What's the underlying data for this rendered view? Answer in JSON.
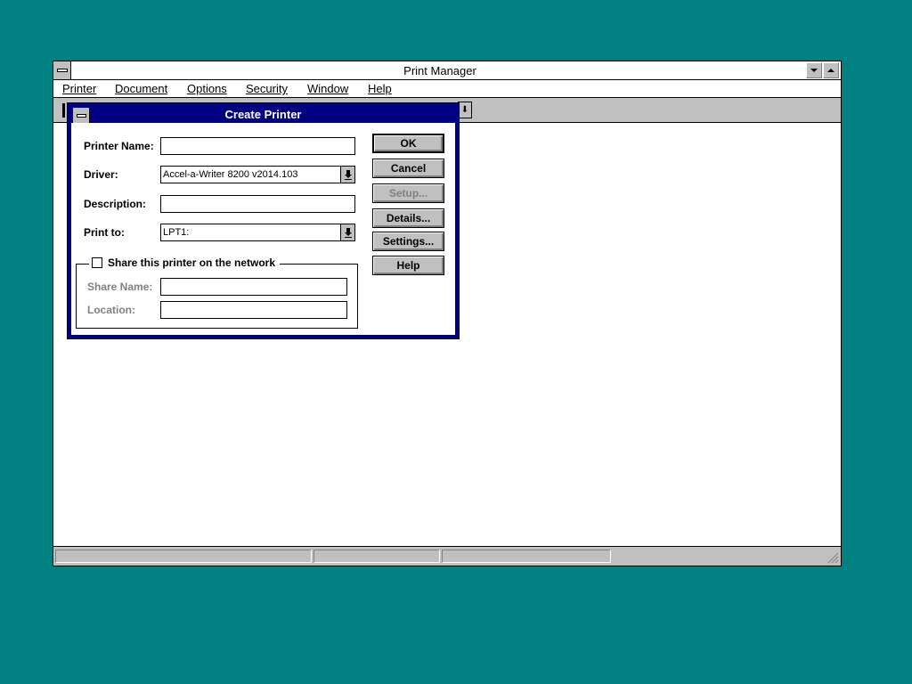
{
  "main_window": {
    "title": "Print Manager",
    "menu": [
      "Printer",
      "Document",
      "Options",
      "Security",
      "Window",
      "Help"
    ]
  },
  "dialog": {
    "title": "Create Printer",
    "fields": {
      "printer_name_label": "Printer Name:",
      "printer_name_value": "",
      "driver_label": "Driver:",
      "driver_value": "Accel-a-Writer 8200 v2014.103",
      "description_label": "Description:",
      "description_value": "",
      "print_to_label": "Print to:",
      "print_to_value": "LPT1:"
    },
    "share_group": {
      "checkbox_label": "Share this printer on the network",
      "checked": false,
      "share_name_label": "Share Name:",
      "share_name_value": "",
      "location_label": "Location:",
      "location_value": ""
    },
    "buttons": {
      "ok": "OK",
      "cancel": "Cancel",
      "setup": "Setup...",
      "details": "Details...",
      "settings": "Settings...",
      "help": "Help"
    }
  },
  "colors": {
    "desktop": "#008080",
    "title_active": "#000080",
    "face": "#c0c0c0"
  }
}
